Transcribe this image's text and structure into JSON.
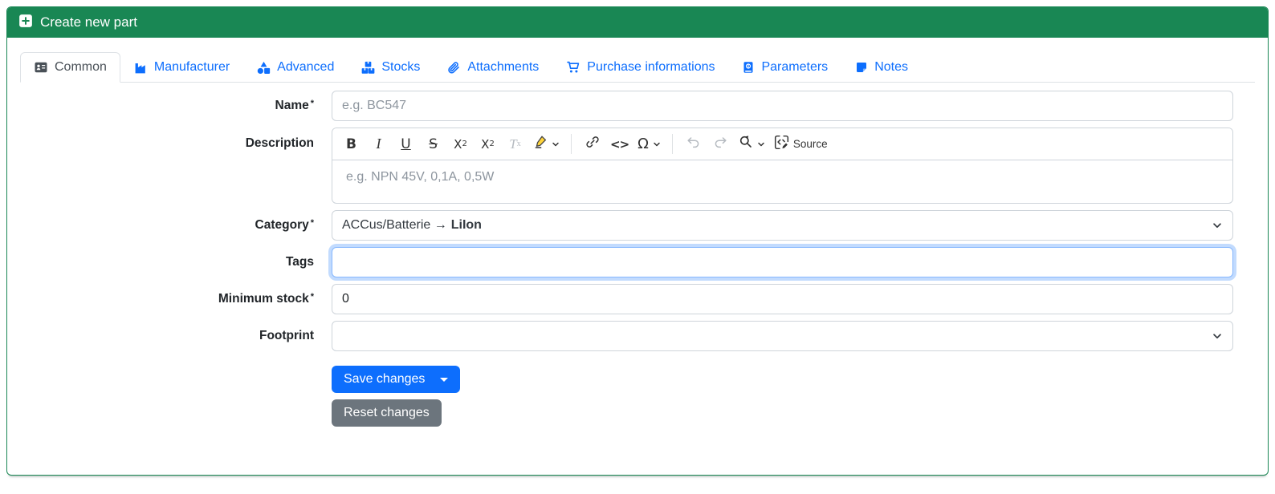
{
  "header": {
    "title": "Create new part"
  },
  "tabs": [
    {
      "label": "Common",
      "active": true
    },
    {
      "label": "Manufacturer"
    },
    {
      "label": "Advanced"
    },
    {
      "label": "Stocks"
    },
    {
      "label": "Attachments"
    },
    {
      "label": "Purchase informations"
    },
    {
      "label": "Parameters"
    },
    {
      "label": "Notes"
    }
  ],
  "form": {
    "required_marker": "*",
    "name": {
      "label": "Name",
      "placeholder": "e.g. BC547",
      "value": ""
    },
    "description": {
      "label": "Description",
      "placeholder": "e.g. NPN 45V, 0,1A, 0,5W",
      "value": ""
    },
    "category": {
      "label": "Category",
      "value_path": "ACCus/Batterie →",
      "value_selected": "LiIon"
    },
    "tags": {
      "label": "Tags",
      "value": ""
    },
    "minimum_stock": {
      "label": "Minimum stock",
      "value": "0"
    },
    "footprint": {
      "label": "Footprint",
      "value": ""
    }
  },
  "editor": {
    "glyphs": {
      "bold": "B",
      "italic": "I",
      "underline": "U",
      "strikethrough": "S",
      "sub_base": "X",
      "sub_small": "2",
      "sup_base": "X",
      "sup_small": "2",
      "remove_base": "T",
      "remove_small": "x",
      "code": "<>",
      "special_char": "Ω",
      "source": "Source"
    }
  },
  "actions": {
    "save": "Save changes",
    "reset": "Reset changes"
  },
  "colors": {
    "header_green": "#198754",
    "link_blue": "#0d6efd",
    "secondary_gray": "#6c757d",
    "focus_ring": "#86b7fe"
  }
}
